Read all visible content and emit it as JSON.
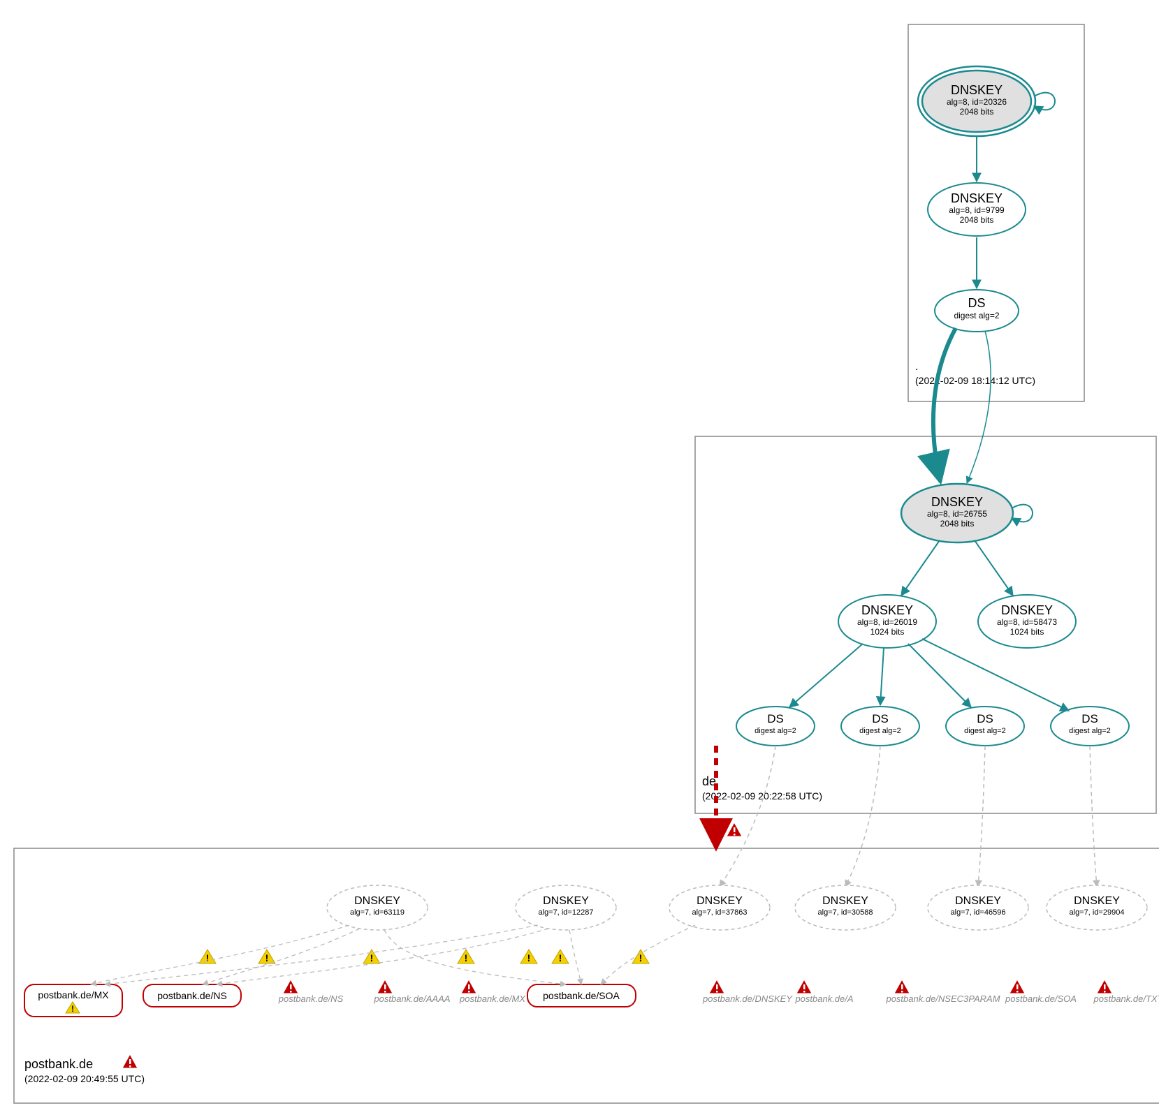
{
  "zones": {
    "root": {
      "label": ".",
      "timestamp": "(2022-02-09 18:14:12 UTC)",
      "ksk": {
        "title": "DNSKEY",
        "line2": "alg=8, id=20326",
        "line3": "2048 bits"
      },
      "zsk": {
        "title": "DNSKEY",
        "line2": "alg=8, id=9799",
        "line3": "2048 bits"
      },
      "ds": {
        "title": "DS",
        "line2": "digest alg=2"
      }
    },
    "de": {
      "label": "de",
      "timestamp": "(2022-02-09 20:22:58 UTC)",
      "ksk": {
        "title": "DNSKEY",
        "line2": "alg=8, id=26755",
        "line3": "2048 bits"
      },
      "zsk1": {
        "title": "DNSKEY",
        "line2": "alg=8, id=26019",
        "line3": "1024 bits"
      },
      "zsk2": {
        "title": "DNSKEY",
        "line2": "alg=8, id=58473",
        "line3": "1024 bits"
      },
      "ds1": {
        "title": "DS",
        "line2": "digest alg=2"
      },
      "ds2": {
        "title": "DS",
        "line2": "digest alg=2"
      },
      "ds3": {
        "title": "DS",
        "line2": "digest alg=2"
      },
      "ds4": {
        "title": "DS",
        "line2": "digest alg=2"
      }
    },
    "postbank": {
      "label": "postbank.de",
      "timestamp": "(2022-02-09 20:49:55 UTC)",
      "dnskeys": {
        "0": {
          "title": "DNSKEY",
          "line2": "alg=7, id=63119"
        },
        "1": {
          "title": "DNSKEY",
          "line2": "alg=7, id=12287"
        },
        "2": {
          "title": "DNSKEY",
          "line2": "alg=7, id=37863"
        },
        "3": {
          "title": "DNSKEY",
          "line2": "alg=7, id=30588"
        },
        "4": {
          "title": "DNSKEY",
          "line2": "alg=7, id=46596"
        },
        "5": {
          "title": "DNSKEY",
          "line2": "alg=7, id=29904"
        }
      },
      "records": {
        "mx": "postbank.de/MX",
        "ns1": "postbank.de/NS",
        "ns2": "postbank.de/NS",
        "aaaa": "postbank.de/AAAA",
        "mx2": "postbank.de/MX",
        "soa": "postbank.de/SOA",
        "dnskey": "postbank.de/DNSKEY",
        "a": "postbank.de/A",
        "nsec3": "postbank.de/NSEC3PARAM",
        "soa2": "postbank.de/SOA",
        "txt": "postbank.de/TXT"
      }
    }
  },
  "colors": {
    "teal": "#1b8a8f",
    "red": "#c00000",
    "gray": "#777777",
    "lightgray": "#bbbbbb",
    "boxborder": "#888888",
    "kskfill": "#e0e0e0"
  }
}
